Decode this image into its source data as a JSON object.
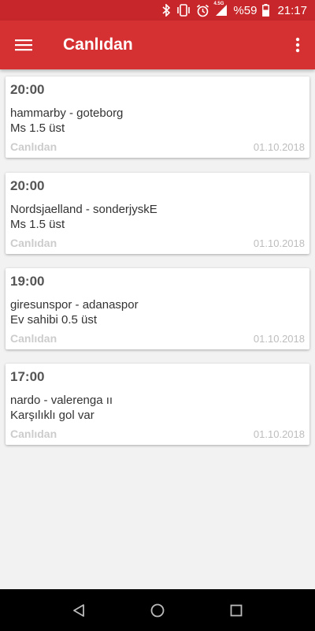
{
  "status_bar": {
    "network": "4.5G",
    "battery": "%59",
    "time": "21:17",
    "icons": [
      "bluetooth-icon",
      "vibrate-icon",
      "alarm-icon",
      "signal-icon",
      "battery-icon"
    ]
  },
  "app_bar": {
    "title": "Canlıdan",
    "menu_icon": "hamburger-icon",
    "more_icon": "more-vert-icon"
  },
  "colors": {
    "status_bar": "#c7272a",
    "app_bar": "#d53032",
    "background": "#f2f2f2"
  },
  "tips": [
    {
      "time": "20:00",
      "match": "hammarby - goteborg",
      "tip": "Ms 1.5 üst",
      "source": "Canlıdan",
      "date": "01.10.2018"
    },
    {
      "time": "20:00",
      "match": "Nordsjaelland - sonderjyskE",
      "tip": "Ms 1.5 üst",
      "source": "Canlıdan",
      "date": "01.10.2018"
    },
    {
      "time": "19:00",
      "match": "giresunspor - adanaspor",
      "tip": "Ev sahibi 0.5 üst",
      "source": "Canlıdan",
      "date": "01.10.2018"
    },
    {
      "time": "17:00",
      "match": "nardo - valerenga ıı",
      "tip": "Karşılıklı gol var",
      "source": "Canlıdan",
      "date": "01.10.2018"
    }
  ],
  "nav_bar": {
    "icons": [
      "back-icon",
      "home-icon",
      "recents-icon"
    ]
  }
}
